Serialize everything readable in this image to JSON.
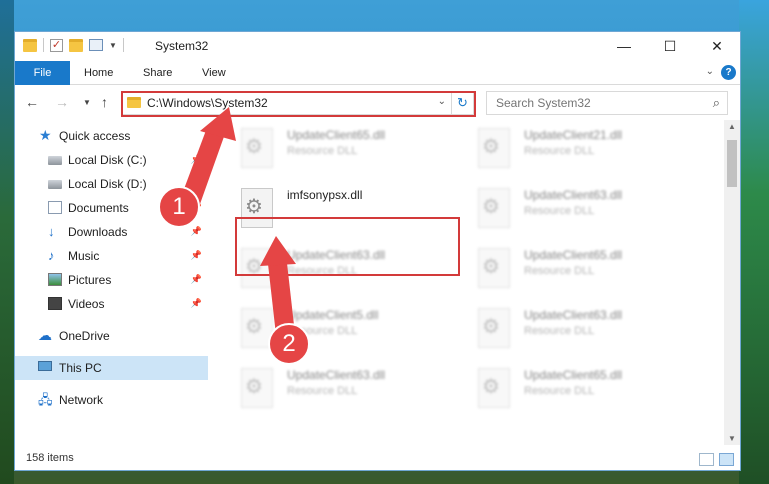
{
  "window": {
    "title": "System32",
    "controls": {
      "minimize": "—",
      "maximize": "☐",
      "close": "✕"
    }
  },
  "ribbon": {
    "tabs": [
      {
        "label": "File"
      },
      {
        "label": "Home"
      },
      {
        "label": "Share"
      },
      {
        "label": "View"
      }
    ],
    "help": "?"
  },
  "address_bar": {
    "path": "C:\\Windows\\System32"
  },
  "search": {
    "placeholder": "Search System32"
  },
  "sidebar": {
    "items": [
      {
        "label": "Quick access",
        "icon": "star-icon"
      },
      {
        "label": "Local Disk (C:)",
        "icon": "drive-icon"
      },
      {
        "label": "Local Disk (D:)",
        "icon": "drive-icon"
      },
      {
        "label": "Documents",
        "icon": "documents-icon"
      },
      {
        "label": "Downloads",
        "icon": "download-icon"
      },
      {
        "label": "Music",
        "icon": "music-icon"
      },
      {
        "label": "Pictures",
        "icon": "pictures-icon"
      },
      {
        "label": "Videos",
        "icon": "videos-icon"
      },
      {
        "label": "OneDrive",
        "icon": "onedrive-icon"
      },
      {
        "label": "This PC",
        "icon": "computer-icon",
        "selected": true
      },
      {
        "label": "Network",
        "icon": "network-icon"
      }
    ]
  },
  "files": [
    {
      "name": "UpdateClient65.dll",
      "type": "Resource DLL"
    },
    {
      "name": "UpdateClient21.dll",
      "type": "Resource DLL"
    },
    {
      "name": "imfsonypsx.dll",
      "type": ""
    },
    {
      "name": "UpdateClient63.dll",
      "type": "Resource DLL"
    },
    {
      "name": "UpdateClient63.dll",
      "type": "Resource DLL"
    },
    {
      "name": "UpdateClient65.dll",
      "type": "Resource DLL"
    },
    {
      "name": "UpdateClient5.dll",
      "type": "Resource DLL"
    },
    {
      "name": "UpdateClient63.dll",
      "type": "Resource DLL"
    },
    {
      "name": "UpdateClient63.dll",
      "type": "Resource DLL"
    },
    {
      "name": "UpdateClient65.dll",
      "type": "Resource DLL"
    }
  ],
  "status": {
    "item_count": "158 items"
  },
  "annotations": {
    "step1": "1",
    "step2": "2",
    "color": "#e54545"
  }
}
